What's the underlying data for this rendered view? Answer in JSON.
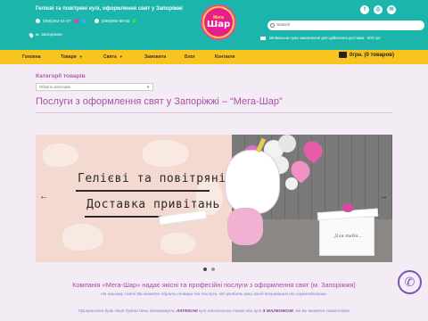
{
  "header": {
    "tagline": "Гелієві та повітряні кулі, оформлення свят у Запоріжжі",
    "phone1": "(066)262-31-07",
    "phone2": "(098)866-99-55",
    "address": "м. Запоріжжя",
    "logo_top": "Мега",
    "logo_bottom": "Шар",
    "search_placeholder": "Search",
    "delivery_note": "Мінімальна сума замовлення для здійснення доставки - 600 грн",
    "social": [
      "facebook-icon",
      "instagram-icon",
      "email-icon"
    ],
    "colors": {
      "header": "#1bb5ac",
      "nav": "#f9c320",
      "accent": "#a74fa7"
    }
  },
  "nav": {
    "items": [
      "Головна",
      "Товари",
      "Свята",
      "Замовити",
      "Блог",
      "Контакти"
    ],
    "cart": "0грн. (0 товаров)"
  },
  "categories": {
    "label": "Категорії товарів",
    "select_value": "Оберіть категорію"
  },
  "page": {
    "title": "Послуги з оформлення свят у Запоріжжі – “Мега-Шар”"
  },
  "slider": {
    "line1": "Гелієві та повітряні кулі",
    "line2": "Доставка привітань",
    "box_text": "Для тебя...",
    "active_dot": 0,
    "dot_count": 2
  },
  "about": {
    "headline_pre": "Компанія «Мега-Шар» надає якісні та професійні послуги з оформлення свят (м. Запоріжжя)",
    "line2": "На нашому сайті Ви можете обрати товари та послуги, які зробить ваш захід яскравішим та гармонійнішим.",
    "line3_pre": "Прикрасити будь-який будній день допоможуть ",
    "line3_b1": "ЛАТЕКСНІ",
    "line3_mid": " кулі пастельних тонів або кулі ",
    "line3_b2": "З МАЛЮНКОМ",
    "line3_post": ", які Ви можете самостійно"
  }
}
